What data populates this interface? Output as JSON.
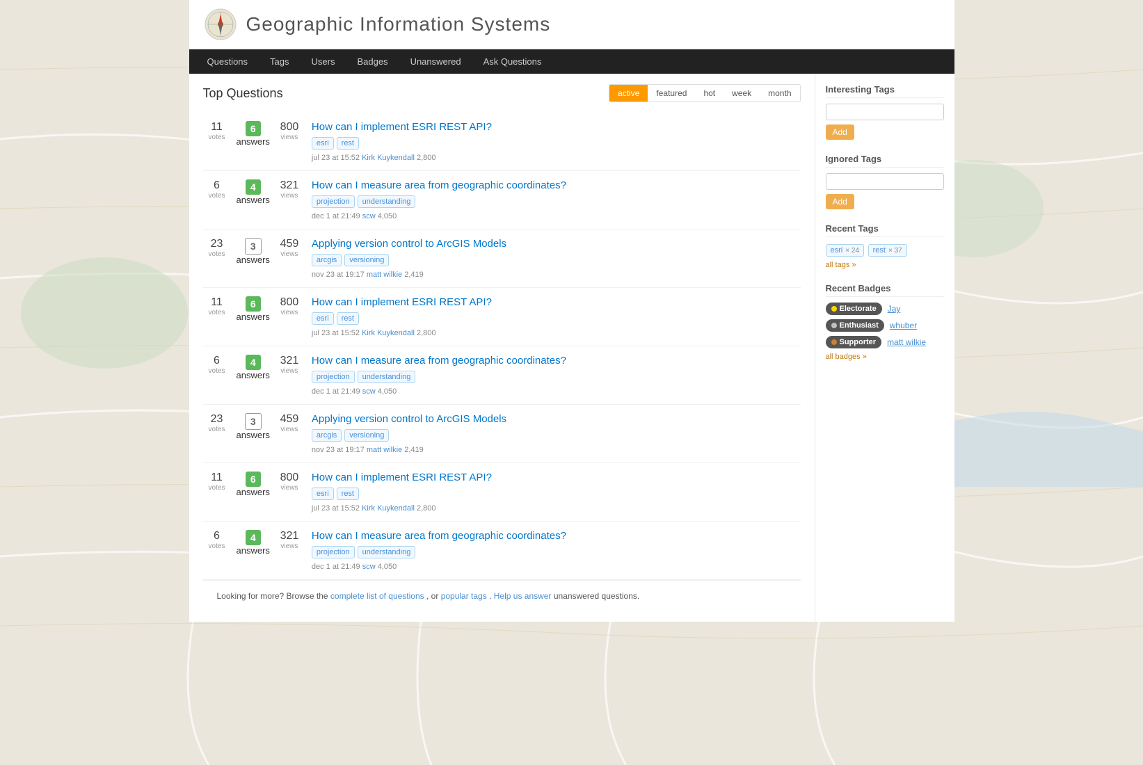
{
  "site": {
    "title": "Geographic Information Systems",
    "logo_alt": "GIS Logo"
  },
  "nav": {
    "items": [
      {
        "label": "Questions",
        "href": "#"
      },
      {
        "label": "Tags",
        "href": "#"
      },
      {
        "label": "Users",
        "href": "#"
      },
      {
        "label": "Badges",
        "href": "#"
      },
      {
        "label": "Unanswered",
        "href": "#"
      },
      {
        "label": "Ask Questions",
        "href": "#"
      }
    ]
  },
  "questions": {
    "title": "Top Questions",
    "filters": [
      {
        "label": "active",
        "active": true
      },
      {
        "label": "featured",
        "active": false
      },
      {
        "label": "hot",
        "active": false
      },
      {
        "label": "week",
        "active": false
      },
      {
        "label": "month",
        "active": false
      }
    ],
    "items": [
      {
        "votes": "11",
        "answers": "6",
        "answers_green": true,
        "views": "800",
        "title": "How can I implement ESRI REST API?",
        "tags": [
          "esri",
          "rest"
        ],
        "date": "jul 23 at 15:52",
        "user": "Kirk Kuykendall",
        "rep": "2,800"
      },
      {
        "votes": "6",
        "answers": "4",
        "answers_green": true,
        "views": "321",
        "title": "How can I measure area from geographic coordinates?",
        "tags": [
          "projection",
          "understanding"
        ],
        "date": "dec 1 at 21:49",
        "user": "scw",
        "rep": "4,050"
      },
      {
        "votes": "23",
        "answers": "3",
        "answers_green": false,
        "views": "459",
        "title": "Applying version control to ArcGIS Models",
        "tags": [
          "arcgis",
          "versioning"
        ],
        "date": "nov 23 at 19:17",
        "user": "matt wilkie",
        "rep": "2,419"
      },
      {
        "votes": "11",
        "answers": "6",
        "answers_green": true,
        "views": "800",
        "title": "How can I implement ESRI REST API?",
        "tags": [
          "esri",
          "rest"
        ],
        "date": "jul 23 at 15:52",
        "user": "Kirk Kuykendall",
        "rep": "2,800"
      },
      {
        "votes": "6",
        "answers": "4",
        "answers_green": true,
        "views": "321",
        "title": "How can I measure area from geographic coordinates?",
        "tags": [
          "projection",
          "understanding"
        ],
        "date": "dec 1 at 21:49",
        "user": "scw",
        "rep": "4,050"
      },
      {
        "votes": "23",
        "answers": "3",
        "answers_green": false,
        "views": "459",
        "title": "Applying version control to ArcGIS Models",
        "tags": [
          "arcgis",
          "versioning"
        ],
        "date": "nov 23 at 19:17",
        "user": "matt wilkie",
        "rep": "2,419"
      },
      {
        "votes": "11",
        "answers": "6",
        "answers_green": true,
        "views": "800",
        "title": "How can I implement ESRI REST API?",
        "tags": [
          "esri",
          "rest"
        ],
        "date": "jul 23 at 15:52",
        "user": "Kirk Kuykendall",
        "rep": "2,800"
      },
      {
        "votes": "6",
        "answers": "4",
        "answers_green": true,
        "views": "321",
        "title": "How can I measure area from geographic coordinates?",
        "tags": [
          "projection",
          "understanding"
        ],
        "date": "dec 1 at 21:49",
        "user": "scw",
        "rep": "4,050"
      }
    ]
  },
  "sidebar": {
    "interesting_tags": {
      "title": "Interesting Tags",
      "placeholder": "",
      "add_label": "Add"
    },
    "ignored_tags": {
      "title": "Ignored Tags",
      "placeholder": "",
      "add_label": "Add"
    },
    "recent_tags": {
      "title": "Recent Tags",
      "items": [
        {
          "name": "esri",
          "count": "× 24"
        },
        {
          "name": "rest",
          "count": "× 37"
        }
      ],
      "all_link": "all tags »"
    },
    "recent_badges": {
      "title": "Recent Badges",
      "items": [
        {
          "badge": "Electorate",
          "type": "gold",
          "user": "Jay"
        },
        {
          "badge": "Enthusiast",
          "type": "silver",
          "user": "whuber"
        },
        {
          "badge": "Supporter",
          "type": "bronze",
          "user": "matt wilkie"
        }
      ],
      "all_link": "all badges »"
    }
  },
  "footer": {
    "text": "Looking for more? Browse the",
    "complete_link": "complete list of questions",
    "or_text": ", or",
    "popular_link": "popular tags",
    "period": ".",
    "help_link": "Help us answer",
    "unanswered_text": "unanswered questions."
  }
}
